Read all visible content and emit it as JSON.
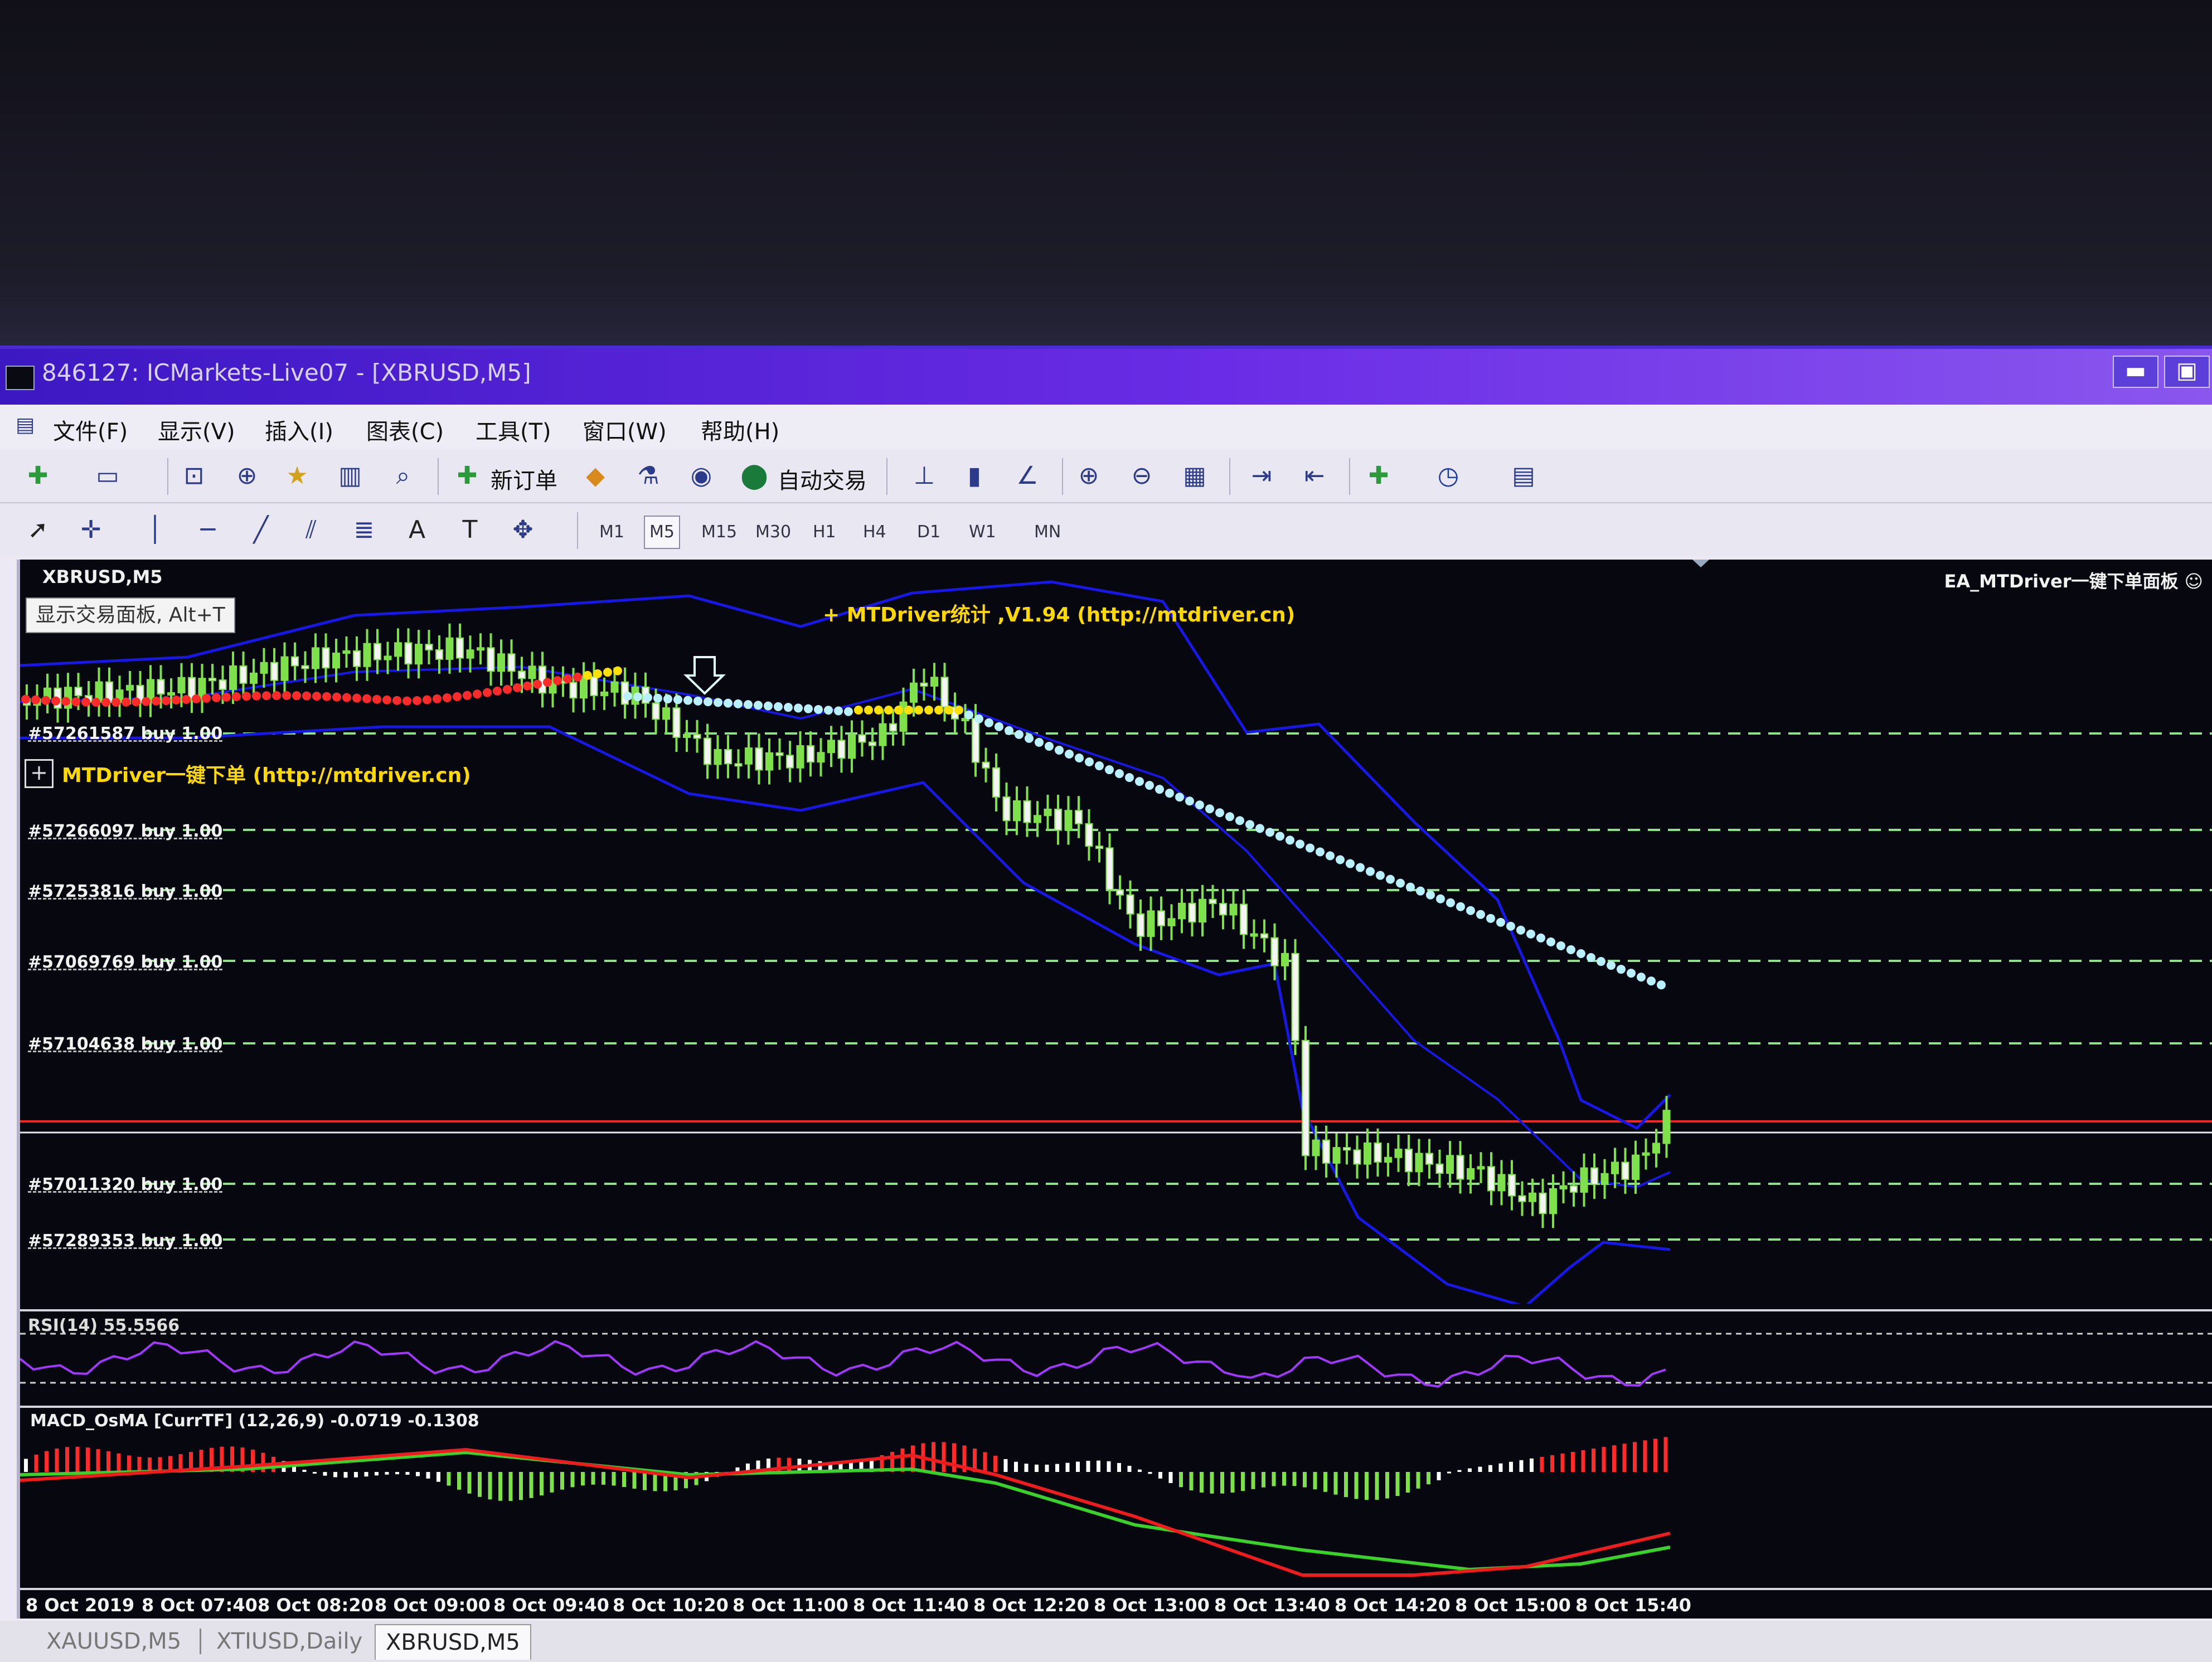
{
  "window": {
    "title": "846127: ICMarkets-Live07 - [XBRUSD,M5]",
    "minimize": "▬",
    "restore": "▣"
  },
  "menu": [
    "文件(F)",
    "显示(V)",
    "插入(I)",
    "图表(C)",
    "工具(T)",
    "窗口(W)",
    "帮助(H)"
  ],
  "toolbar": {
    "new_order": "新订单",
    "auto_trading": "自动交易",
    "timeframes": [
      "M1",
      "M5",
      "M15",
      "M30",
      "H1",
      "H4",
      "D1",
      "W1",
      "MN"
    ],
    "active_timeframe": "M5",
    "text_tool": "A",
    "text_label_tool": "T"
  },
  "chart": {
    "symbol": "XBRUSD,M5",
    "tooltip": "显示交易面板, Alt+T",
    "ea_label": "EA_MTDriver一键下单面板 ☺",
    "stats_label": "+   MTDriver统计 ,V1.94 (http://mtdriver.cn)",
    "panel_label": "MTDriver一键下单 (http://mtdriver.cn)",
    "panel_plus": "+",
    "orders": [
      "#57261587 buy 1.00",
      "#57266097 buy 1.00",
      "#57253816 buy 1.00",
      "#57069769 buy 1.00",
      "#57104638 buy 1.00",
      "#57011320 buy 1.00",
      "#57289353 buy 1.00"
    ],
    "colors": {
      "background": "#07070f",
      "bull_candle": "#7ee04a",
      "bear_candle": "#f4f4f4",
      "bollinger": "#1717e8",
      "order_line": "#8ee28a",
      "bid_line": "#ff2020",
      "sar_red": "#ff2a2a",
      "sar_yellow": "#ffe000",
      "sar_cyan": "#b8f0ff"
    }
  },
  "rsi": {
    "label": "RSI(14) 55.5566"
  },
  "macd": {
    "label": "MACD_OsMA [CurrTF] (12,26,9) -0.0719 -0.1308"
  },
  "time_axis": [
    "8 Oct 2019",
    "8 Oct 07:40",
    "8 Oct 08:20",
    "8 Oct 09:00",
    "8 Oct 09:40",
    "8 Oct 10:20",
    "8 Oct 11:00",
    "8 Oct 11:40",
    "8 Oct 12:20",
    "8 Oct 13:00",
    "8 Oct 13:40",
    "8 Oct 14:20",
    "8 Oct 15:00",
    "8 Oct 15:40"
  ],
  "tabs": [
    "XAUUSD,M5",
    "XTIUSD,Daily",
    "XBRUSD,M5"
  ],
  "active_tab": "XBRUSD,M5"
}
